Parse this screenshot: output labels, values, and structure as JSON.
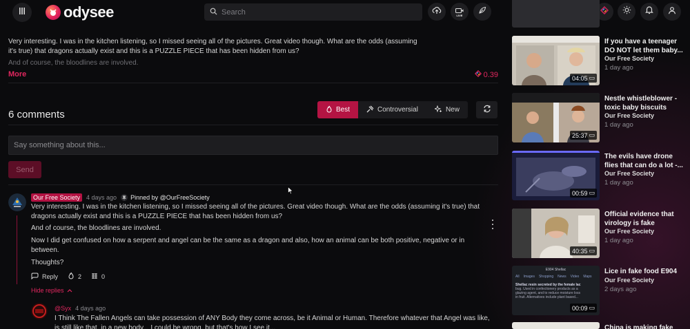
{
  "header": {
    "logo_text": "odysee",
    "search_placeholder": "Search",
    "live_label": "LIVE",
    "icons": [
      "menu-icon",
      "search-icon",
      "upload-icon",
      "live-icon",
      "publish-icon",
      "credits-icon",
      "theme-icon",
      "notifications-icon",
      "account-icon"
    ]
  },
  "description": {
    "text": "Very interesting. I was in the kitchen listening, so I missed seeing all of the pictures. Great video though. What are the odds (assuming it's true) that dragons actually exist and this is a PUZZLE PIECE that has been hidden from us?",
    "faded": "And of course, the bloodlines are involved.",
    "more_label": "More",
    "credits_value": "0.39"
  },
  "comments": {
    "title": "6 comments",
    "sort": [
      {
        "label": "Best",
        "icon": "fire-icon",
        "active": true
      },
      {
        "label": "Controversial",
        "icon": "controversial-icon",
        "active": false
      },
      {
        "label": "New",
        "icon": "sparkle-icon",
        "active": false
      }
    ],
    "input_placeholder": "Say something about this...",
    "send_label": "Send",
    "first": {
      "author": "Our Free Society",
      "time": "4 days ago",
      "pinned": "Pinned by @OurFreeSociety",
      "p1": "Very interesting. I was in the kitchen listening, so I missed seeing all of the pictures. Great video though. What are the odds (assuming it's true) that",
      "p1b": "dragons actually exist and this is a PUZZLE PIECE that has been hidden from us?",
      "p2": "And of course, the bloodlines are involved.",
      "p3": "Now I did get confused on how a serpent and angel can be the same as a dragon and also, how an animal can be both positive, negative or in",
      "p3b": "between.",
      "p4": "Thoughts?",
      "reply_label": "Reply",
      "fire_count": "2",
      "slime_count": "0",
      "hide_replies_label": "Hide replies"
    },
    "reply": {
      "author": "@Syx",
      "time": "4 days ago",
      "line1": "I Think The Fallen Angels can take possession of ANY Body they come across, be it Animal or Human. Therefore whatever that Angel was like,",
      "line2": "is still like that, in a new body... I could be wrong, but that's how I see it..."
    }
  },
  "sidebar": {
    "videos": [
      {
        "title": "If you have a teenager DO NOT let them baby...",
        "channel": "Our Free Society",
        "age": "1 day ago",
        "duration": "04:05"
      },
      {
        "title": "Nestle whistleblower - toxic baby biscuits and...",
        "channel": "Our Free Society",
        "age": "1 day ago",
        "duration": "25:37"
      },
      {
        "title": "The evils have drone flies that can do a lot -...",
        "channel": "Our Free Society",
        "age": "1 day ago",
        "duration": "00:59"
      },
      {
        "title": "Official evidence that virology is fake science...",
        "channel": "Our Free Society",
        "age": "1 day ago",
        "duration": "40:35"
      },
      {
        "title": "Lice in fake food E904",
        "channel": "Our Free Society",
        "age": "2 days ago",
        "duration": "00:09"
      },
      {
        "title": "China is making fake",
        "channel": "",
        "age": "",
        "duration": ""
      }
    ],
    "thumb5": {
      "heading": "E904 Shellac",
      "tabs": [
        "All",
        "Images",
        "Shopping",
        "News",
        "Video",
        "Maps"
      ],
      "line1": "Shellac resin secreted by the female lac",
      "line2": "bug. Used in confectionery products as a",
      "line3": "glazing agent, and to reduce moisture loss",
      "line4": "in fruit. Alternatives include plant based..."
    }
  },
  "colors": {
    "accent": "#e1275f",
    "accent_dark": "#b41443",
    "background": "#0b0b0d",
    "surface": "#1d1d20"
  }
}
